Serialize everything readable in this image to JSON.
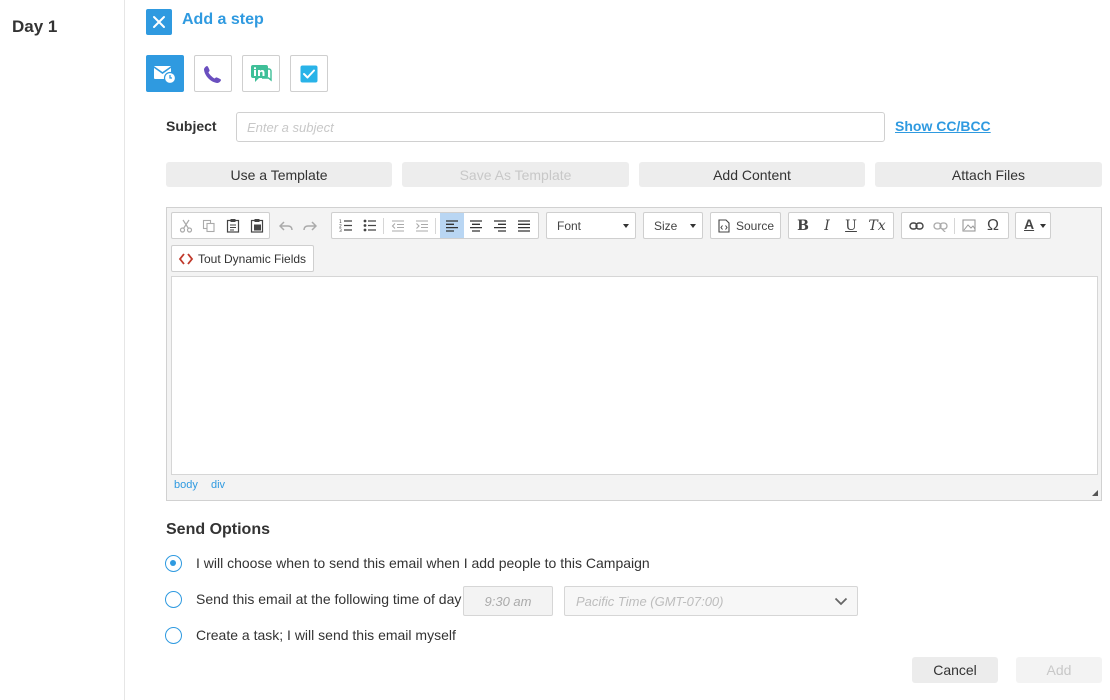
{
  "day": {
    "label": "Day 1"
  },
  "header": {
    "title": "Add a step",
    "close_icon": "close-icon"
  },
  "step_types": [
    {
      "name": "email",
      "icon": "email-clock-icon",
      "active": true
    },
    {
      "name": "call",
      "icon": "phone-icon",
      "active": false
    },
    {
      "name": "linkedin",
      "icon": "linkedin-chat-icon",
      "active": false
    },
    {
      "name": "task",
      "icon": "checkbox-icon",
      "active": false
    }
  ],
  "subject": {
    "label": "Subject",
    "placeholder": "Enter a subject",
    "value": "",
    "cc_link": "Show CC/BCC"
  },
  "template_buttons": {
    "use_template": "Use a Template",
    "save_template": "Save As Template",
    "add_content": "Add Content",
    "attach_files": "Attach Files"
  },
  "toolbar": {
    "font_label": "Font",
    "size_label": "Size",
    "source_label": "Source",
    "dynamic_fields_label": "Tout Dynamic Fields",
    "bold": "B",
    "italic": "I",
    "underline": "U",
    "remove_format": "Tx",
    "special_char": "Ω",
    "text_color": "A"
  },
  "status_path": [
    "body",
    "div"
  ],
  "send_options": {
    "title": "Send Options",
    "options": [
      {
        "label": "I will choose when to send this email when I add people to this Campaign",
        "checked": true
      },
      {
        "label": "Send this email at the following time of day",
        "checked": false
      },
      {
        "label": "Create a task; I will send this email myself",
        "checked": false
      }
    ],
    "time_value": "9:30 am",
    "timezone_value": "Pacific Time (GMT-07:00)"
  },
  "footer": {
    "cancel_label": "Cancel",
    "add_label": "Add"
  },
  "colors": {
    "accent": "#2f9ae0",
    "button_bg": "#ededed",
    "disabled_text": "#c8c8c8"
  }
}
